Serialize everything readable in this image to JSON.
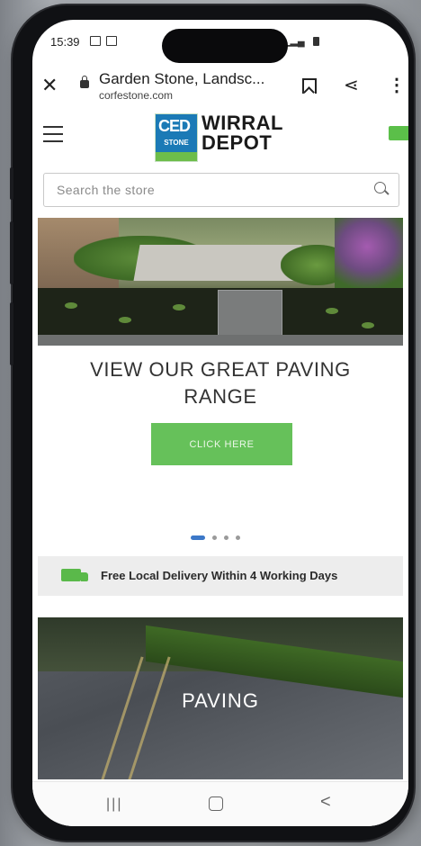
{
  "status_bar": {
    "time": "15:39"
  },
  "browser": {
    "page_title": "Garden Stone, Landsc...",
    "domain": "corfestone.com"
  },
  "site": {
    "logo": {
      "badge_top": "CED",
      "badge_bottom": "STONE",
      "name_line1": "WIRRAL",
      "name_line2": "DEPOT"
    },
    "search_placeholder": "Search the store"
  },
  "hero": {
    "title_line1": "VIEW OUR GREAT PAVING",
    "title_line2": "RANGE",
    "cta_label": "CLICK HERE",
    "slides_total": 4,
    "slide_active": 1
  },
  "delivery_banner": {
    "text": "Free Local Delivery Within 4 Working Days"
  },
  "category_tile": {
    "label": "PAVING"
  },
  "colors": {
    "cta_green": "#66c15a",
    "brand_blue": "#1b7ab6",
    "dot_active": "#3c78c8"
  },
  "icons": [
    "close-icon",
    "lock-icon",
    "bookmark-icon",
    "share-icon",
    "more-icon",
    "hamburger-icon",
    "cart-icon",
    "search-icon",
    "truck-icon",
    "recents-icon",
    "home-icon",
    "back-icon"
  ]
}
